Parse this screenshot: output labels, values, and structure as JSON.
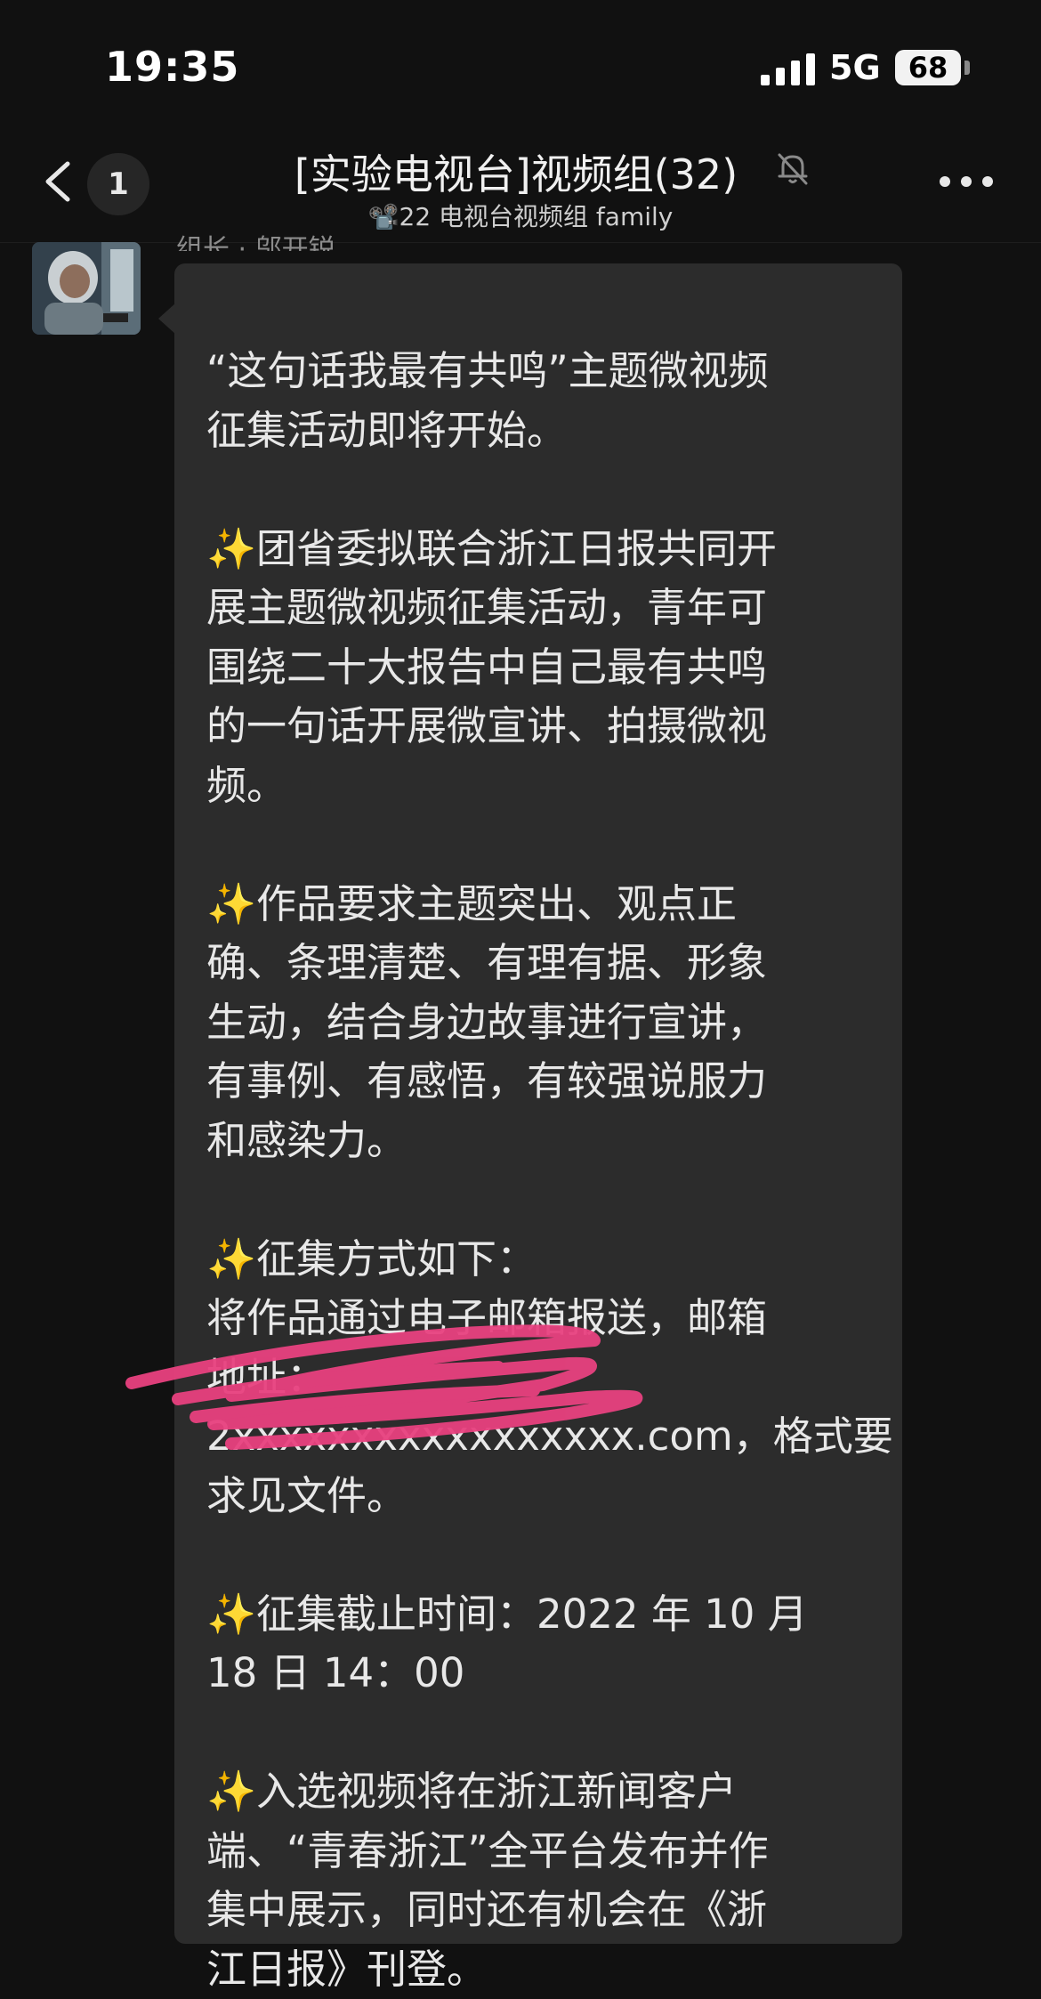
{
  "status_bar": {
    "time": "19:35",
    "network": "5G",
    "battery": "68"
  },
  "nav": {
    "back_icon": "chevron-left-icon",
    "unread_count": "1",
    "title": "[实验电视台]视频组(32)",
    "mute_icon": "bell-slash-icon",
    "subtitle": "📽️22 电视台视频组 family",
    "more_icon": "ellipsis-icon"
  },
  "message": {
    "sender": "组长 · 邬开锐",
    "avatar_icon": "astronaut-avatar",
    "paragraphs": [
      {
        "lines": [
          "“这句话我最有共鸣”主题微视频",
          "征集活动即将开始。"
        ]
      },
      {
        "lines": [
          "✨团省委拟联合浙江日报共同开",
          "展主题微视频征集活动，青年可",
          "围绕二十大报告中自己最有共鸣",
          "的一句话开展微宣讲、拍摄微视",
          "频。"
        ]
      },
      {
        "lines": [
          "✨作品要求主题突出、观点正",
          "确、条理清楚、有理有据、形象",
          "生动，结合身边故事进行宣讲，",
          "有事例、有感悟，有较强说服力",
          "和感染力。"
        ]
      },
      {
        "lines": [
          "✨征集方式如下：",
          "将作品通过电子邮箱报送，邮箱",
          "地址：",
          "2xxxxxxxxxxxxxxxxx.com，格式要",
          "求见文件。"
        ]
      },
      {
        "lines": [
          "✨征集截止时间：2022 年 10 月",
          "18 日 14：00"
        ]
      },
      {
        "lines": [
          "✨入选视频将在浙江新闻客户",
          "端、“青春浙江”全平台发布并作",
          "集中展示，同时还有机会在《浙",
          "江日报》刊登。"
        ]
      }
    ]
  },
  "colors": {
    "background": "#111111",
    "bubble": "#2c2c2c",
    "text": "#e8e8e8",
    "scribble": "#e8417f"
  }
}
